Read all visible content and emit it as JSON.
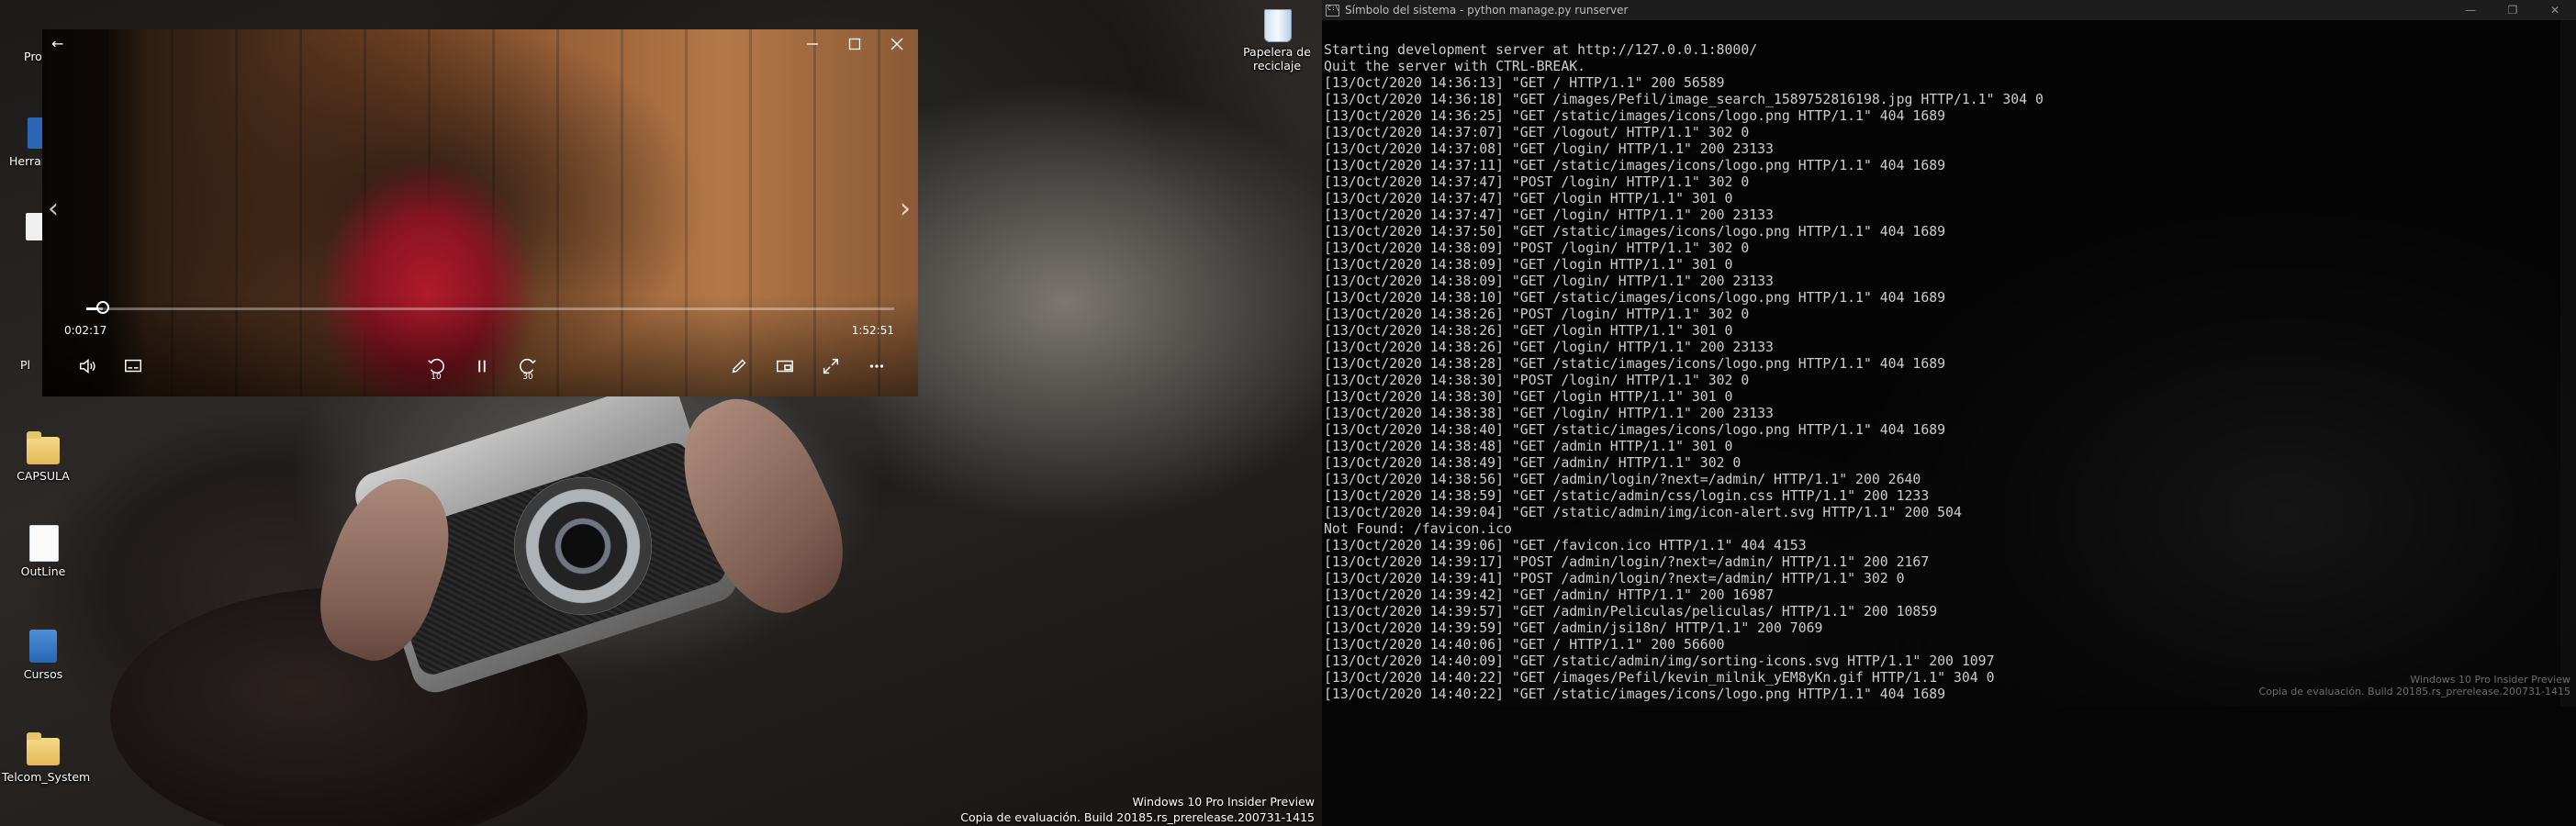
{
  "desktop": {
    "icons": [
      {
        "label": "CAPSULA",
        "name": "capsula-folder"
      },
      {
        "label": "OutLine",
        "name": "outline-document"
      },
      {
        "label": "Cursos",
        "name": "cursos-document"
      },
      {
        "label": "Telcom_System",
        "name": "telcom-system-folder"
      }
    ],
    "partial_labels": [
      "Pro",
      "Herrar",
      "Pl"
    ],
    "recycle_bin": {
      "line1": "Papelera de",
      "line2": "reciclaje"
    },
    "watermark": {
      "line1": "Windows 10 Pro Insider Preview",
      "line2": "Copia de evaluación. Build 20185.rs_prerelease.200731-1415"
    }
  },
  "player": {
    "elapsed": "0:02:17",
    "duration": "1:52:51",
    "progress_fraction": 0.02,
    "icons": {
      "minimize": "minimize-icon",
      "maximize": "maximize-icon",
      "close": "close-icon",
      "back": "back-arrow-icon",
      "prev": "previous-chevron-icon",
      "next": "next-chevron-icon",
      "volume": "volume-icon",
      "subtitles": "subtitles-icon",
      "skip_back": "skip-back-10-icon",
      "pause": "pause-icon",
      "skip_forward": "skip-forward-30-icon",
      "edit": "pencil-icon",
      "mini_view": "mini-view-icon",
      "fullscreen": "fullscreen-icon",
      "more": "more-icon"
    },
    "skip_back_label": "10",
    "skip_forward_label": "30"
  },
  "console": {
    "title": "Símbolo del sistema - python  manage.py runserver",
    "lines": [
      "Starting development server at http://127.0.0.1:8000/",
      "Quit the server with CTRL-BREAK.",
      "[13/Oct/2020 14:36:13] \"GET / HTTP/1.1\" 200 56589",
      "[13/Oct/2020 14:36:18] \"GET /images/Pefil/image_search_1589752816198.jpg HTTP/1.1\" 304 0",
      "[13/Oct/2020 14:36:25] \"GET /static/images/icons/logo.png HTTP/1.1\" 404 1689",
      "[13/Oct/2020 14:37:07] \"GET /logout/ HTTP/1.1\" 302 0",
      "[13/Oct/2020 14:37:08] \"GET /login/ HTTP/1.1\" 200 23133",
      "[13/Oct/2020 14:37:11] \"GET /static/images/icons/logo.png HTTP/1.1\" 404 1689",
      "[13/Oct/2020 14:37:47] \"POST /login/ HTTP/1.1\" 302 0",
      "[13/Oct/2020 14:37:47] \"GET /login HTTP/1.1\" 301 0",
      "[13/Oct/2020 14:37:47] \"GET /login/ HTTP/1.1\" 200 23133",
      "[13/Oct/2020 14:37:50] \"GET /static/images/icons/logo.png HTTP/1.1\" 404 1689",
      "[13/Oct/2020 14:38:09] \"POST /login/ HTTP/1.1\" 302 0",
      "[13/Oct/2020 14:38:09] \"GET /login HTTP/1.1\" 301 0",
      "[13/Oct/2020 14:38:09] \"GET /login/ HTTP/1.1\" 200 23133",
      "[13/Oct/2020 14:38:10] \"GET /static/images/icons/logo.png HTTP/1.1\" 404 1689",
      "[13/Oct/2020 14:38:26] \"POST /login/ HTTP/1.1\" 302 0",
      "[13/Oct/2020 14:38:26] \"GET /login HTTP/1.1\" 301 0",
      "[13/Oct/2020 14:38:26] \"GET /login/ HTTP/1.1\" 200 23133",
      "[13/Oct/2020 14:38:28] \"GET /static/images/icons/logo.png HTTP/1.1\" 404 1689",
      "[13/Oct/2020 14:38:30] \"POST /login/ HTTP/1.1\" 302 0",
      "[13/Oct/2020 14:38:30] \"GET /login HTTP/1.1\" 301 0",
      "[13/Oct/2020 14:38:38] \"GET /login/ HTTP/1.1\" 200 23133",
      "[13/Oct/2020 14:38:40] \"GET /static/images/icons/logo.png HTTP/1.1\" 404 1689",
      "[13/Oct/2020 14:38:48] \"GET /admin HTTP/1.1\" 301 0",
      "[13/Oct/2020 14:38:49] \"GET /admin/ HTTP/1.1\" 302 0",
      "[13/Oct/2020 14:38:56] \"GET /admin/login/?next=/admin/ HTTP/1.1\" 200 2640",
      "[13/Oct/2020 14:38:59] \"GET /static/admin/css/login.css HTTP/1.1\" 200 1233",
      "[13/Oct/2020 14:39:04] \"GET /static/admin/img/icon-alert.svg HTTP/1.1\" 200 504",
      "Not Found: /favicon.ico",
      "[13/Oct/2020 14:39:06] \"GET /favicon.ico HTTP/1.1\" 404 4153",
      "[13/Oct/2020 14:39:17] \"POST /admin/login/?next=/admin/ HTTP/1.1\" 200 2167",
      "[13/Oct/2020 14:39:41] \"POST /admin/login/?next=/admin/ HTTP/1.1\" 302 0",
      "[13/Oct/2020 14:39:42] \"GET /admin/ HTTP/1.1\" 200 16987",
      "[13/Oct/2020 14:39:57] \"GET /admin/Peliculas/peliculas/ HTTP/1.1\" 200 10859",
      "[13/Oct/2020 14:39:59] \"GET /admin/jsi18n/ HTTP/1.1\" 200 7069",
      "[13/Oct/2020 14:40:06] \"GET / HTTP/1.1\" 200 56600",
      "[13/Oct/2020 14:40:09] \"GET /static/admin/img/sorting-icons.svg HTTP/1.1\" 200 1097",
      "[13/Oct/2020 14:40:22] \"GET /images/Pefil/kevin_milnik_yEM8yKn.gif HTTP/1.1\" 304 0",
      "[13/Oct/2020 14:40:22] \"GET /static/images/icons/logo.png HTTP/1.1\" 404 1689"
    ],
    "watermark": {
      "line1": "Windows 10 Pro Insider Preview",
      "line2": "Copia de evaluación. Build 20185.rs_prerelease.200731-1415"
    }
  }
}
